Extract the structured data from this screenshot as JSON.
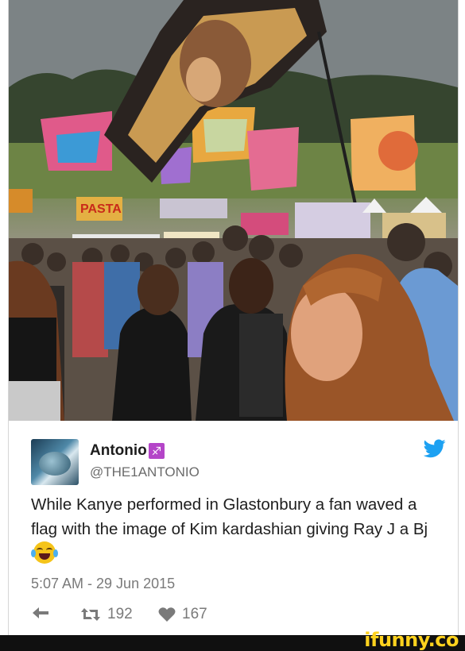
{
  "tweet": {
    "author_name": "Antonio",
    "author_badge": "♐",
    "handle": "@THE1ANTONIO",
    "text": "While Kanye performed in Glastonbury a fan waved a flag with the image of Kim kardashian giving Ray J a Bj",
    "emoji": "face-with-tears-of-joy",
    "timestamp": "5:07 AM - 29 Jun 2015",
    "retweets": "192",
    "likes": "167"
  },
  "photo": {
    "signs": [
      "PASTA"
    ]
  },
  "footer": {
    "watermark": "ifunny.co"
  },
  "colors": {
    "twitter_blue": "#1da1f2",
    "watermark_yellow": "#ffd21e",
    "muted_text": "#7a7a7a",
    "badge_purple": "#b445c8"
  }
}
